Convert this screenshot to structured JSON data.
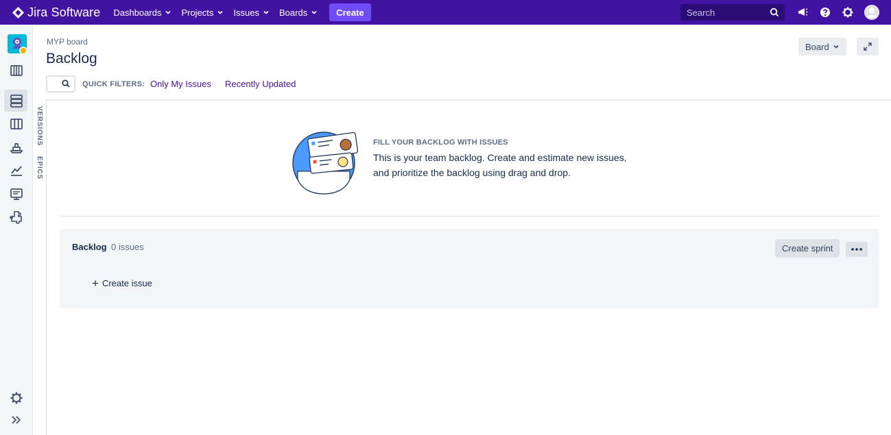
{
  "topnav": {
    "product_name": "Jira Software",
    "menu": [
      {
        "label": "Dashboards"
      },
      {
        "label": "Projects"
      },
      {
        "label": "Issues"
      },
      {
        "label": "Boards"
      }
    ],
    "create_label": "Create",
    "search_placeholder": "Search",
    "icons": [
      "notifications-icon",
      "help-icon",
      "settings-icon",
      "user-avatar"
    ],
    "bg_color": "#4213a3",
    "create_color": "#6f4cf5"
  },
  "sidebar": {
    "items": [
      "project-avatar",
      "roadmap-icon",
      "backlog-icon",
      "board-icon",
      "releases-icon",
      "reports-icon",
      "issues-icon",
      "add-item-icon"
    ],
    "bottom": [
      "project-settings-icon",
      "expand-sidebar-icon"
    ],
    "active": "backlog-icon"
  },
  "vertical_tabs": {
    "versions": "VERSIONS",
    "epics": "EPICS"
  },
  "header": {
    "breadcrumb": "MYP board",
    "title": "Backlog",
    "board_button": "Board",
    "quick_filters_label": "QUICK FILTERS:",
    "quick_filters": [
      "Only My Issues",
      "Recently Updated"
    ]
  },
  "empty_state": {
    "heading": "FILL YOUR BACKLOG WITH ISSUES",
    "line1": "This is your team backlog. Create and estimate new issues,",
    "line2": "and prioritize the backlog using drag and drop."
  },
  "backlog": {
    "title": "Backlog",
    "count": "0 issues",
    "create_sprint": "Create sprint",
    "create_issue": "Create issue"
  }
}
